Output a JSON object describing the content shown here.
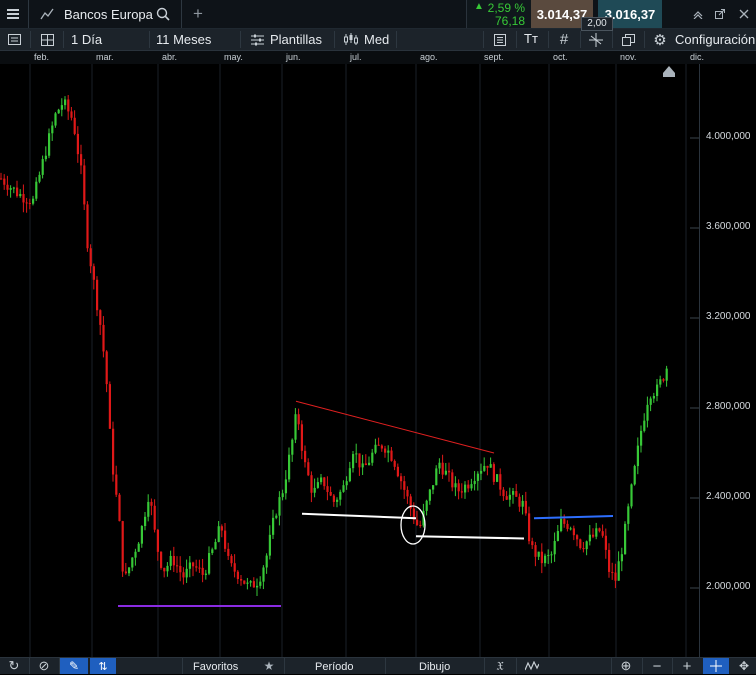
{
  "topbar": {
    "instrument": "Bancos Europa",
    "change_percent": "2,59 %",
    "change_points": "76,18",
    "sell_price": "3.014,37",
    "buy_price": "3.016,37",
    "spread": "2,00"
  },
  "toolbar": {
    "interval": "1 Día",
    "range": "11 Meses",
    "templates": "Plantillas",
    "price_type": "Med",
    "text_tool": "Tт",
    "settings": "Configuración"
  },
  "x_axis": {
    "months": [
      "feb.",
      "mar.",
      "abr.",
      "may.",
      "jun.",
      "jul.",
      "ago.",
      "sept.",
      "oct.",
      "nov.",
      "dic."
    ]
  },
  "y_axis": {
    "ticks": [
      "4.000,000",
      "3.600,000",
      "3.200,000",
      "2.800,000",
      "2.400,000",
      "2.000,000"
    ]
  },
  "bottombar": {
    "favorites": "Favoritos",
    "period": "Período",
    "drawing": "Dibujo"
  },
  "colors": {
    "up": "#37c837",
    "down": "#e01818",
    "resistance_line": "#e02020",
    "support_purple": "#8a2be2",
    "level_blue": "#2e6fff",
    "level_white": "#ffffff"
  },
  "chart_data": {
    "type": "candlestick",
    "ylim": [
      1750000,
      4250000
    ],
    "y_ticks": [
      4000000,
      3600000,
      3200000,
      2800000,
      2400000,
      2000000
    ],
    "x_months": [
      "feb.",
      "mar.",
      "abr.",
      "may.",
      "jun.",
      "jul.",
      "ago.",
      "sept.",
      "oct.",
      "nov.",
      "dic."
    ],
    "price_path": [
      [
        0,
        3820000
      ],
      [
        18,
        3750000
      ],
      [
        32,
        3720000
      ],
      [
        45,
        3950000
      ],
      [
        55,
        4110000
      ],
      [
        62,
        4160000
      ],
      [
        72,
        4080000
      ],
      [
        80,
        3850000
      ],
      [
        86,
        3550000
      ],
      [
        93,
        3350000
      ],
      [
        100,
        3150000
      ],
      [
        105,
        2950000
      ],
      [
        110,
        2600000
      ],
      [
        118,
        2300000
      ],
      [
        123,
        2020000
      ],
      [
        130,
        2120000
      ],
      [
        140,
        2250000
      ],
      [
        148,
        2430000
      ],
      [
        155,
        2200000
      ],
      [
        162,
        2080000
      ],
      [
        172,
        2130000
      ],
      [
        182,
        2050000
      ],
      [
        192,
        2100000
      ],
      [
        202,
        2060000
      ],
      [
        212,
        2170000
      ],
      [
        220,
        2280000
      ],
      [
        228,
        2100000
      ],
      [
        238,
        2060000
      ],
      [
        248,
        2000000
      ],
      [
        258,
        2040000
      ],
      [
        266,
        2150000
      ],
      [
        274,
        2330000
      ],
      [
        282,
        2440000
      ],
      [
        290,
        2620000
      ],
      [
        296,
        2790000
      ],
      [
        303,
        2560000
      ],
      [
        312,
        2420000
      ],
      [
        322,
        2480000
      ],
      [
        332,
        2380000
      ],
      [
        342,
        2440000
      ],
      [
        352,
        2620000
      ],
      [
        362,
        2520000
      ],
      [
        372,
        2600000
      ],
      [
        382,
        2640000
      ],
      [
        392,
        2580000
      ],
      [
        400,
        2480000
      ],
      [
        410,
        2350000
      ],
      [
        418,
        2260000
      ],
      [
        428,
        2410000
      ],
      [
        438,
        2560000
      ],
      [
        446,
        2500000
      ],
      [
        456,
        2430000
      ],
      [
        466,
        2460000
      ],
      [
        476,
        2520000
      ],
      [
        486,
        2560000
      ],
      [
        494,
        2490000
      ],
      [
        504,
        2420000
      ],
      [
        514,
        2400000
      ],
      [
        522,
        2370000
      ],
      [
        530,
        2180000
      ],
      [
        540,
        2120000
      ],
      [
        550,
        2140000
      ],
      [
        560,
        2290000
      ],
      [
        570,
        2280000
      ],
      [
        580,
        2190000
      ],
      [
        590,
        2220000
      ],
      [
        600,
        2260000
      ],
      [
        608,
        2080000
      ],
      [
        614,
        2030000
      ],
      [
        622,
        2200000
      ],
      [
        632,
        2480000
      ],
      [
        640,
        2700000
      ],
      [
        648,
        2870000
      ],
      [
        656,
        2880000
      ],
      [
        663,
        2950000
      ],
      [
        668,
        3010000
      ]
    ],
    "annotations": [
      {
        "type": "trendline",
        "color": "resistance",
        "from": [
          296,
          2830000
        ],
        "to": [
          494,
          2600000
        ]
      },
      {
        "type": "hline",
        "color": "white",
        "from": [
          302,
          2330000
        ],
        "to": [
          416,
          2310000
        ]
      },
      {
        "type": "hline",
        "color": "white",
        "from": [
          416,
          2230000
        ],
        "to": [
          524,
          2220000
        ]
      },
      {
        "type": "ellipse",
        "color": "white",
        "center": [
          413,
          2280000
        ],
        "rx": 12,
        "ry": 19
      },
      {
        "type": "hline",
        "color": "support",
        "from": [
          118,
          1920000
        ],
        "to": [
          281,
          1920000
        ]
      },
      {
        "type": "hline",
        "color": "level",
        "from": [
          534,
          2310000
        ],
        "to": [
          613,
          2320000
        ]
      }
    ]
  }
}
